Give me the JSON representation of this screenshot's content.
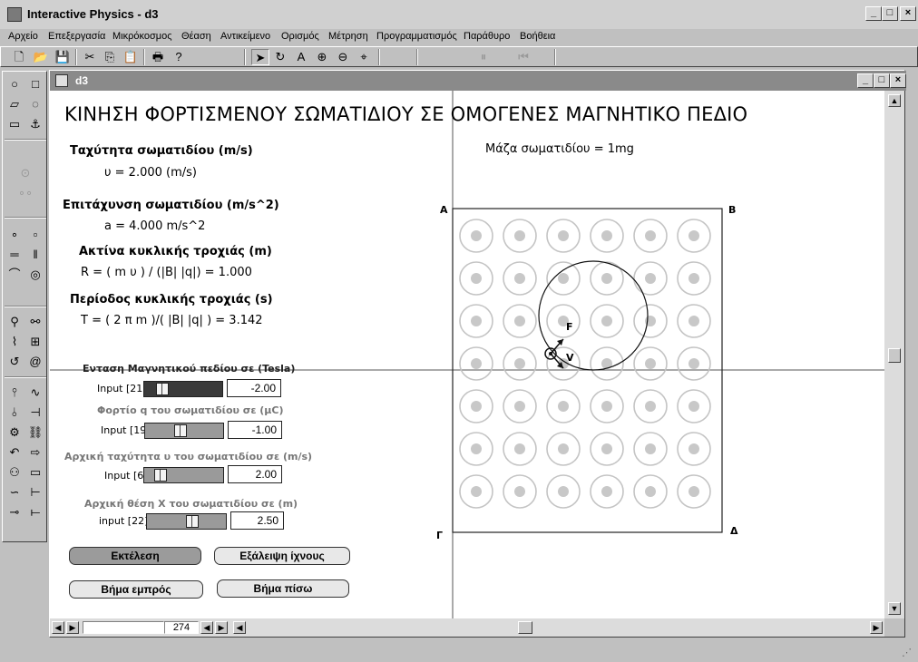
{
  "app": {
    "title": "Interactive Physics - d3",
    "window_controls": [
      "_",
      "□",
      "×"
    ]
  },
  "menu": [
    "Αρχείο",
    "Επεξεργασία",
    "Μικρόκοσμος",
    "Θέαση",
    "Αντικείμενο",
    "Ορισμός",
    "Μέτρηση",
    "Προγραμματισμός",
    "Παράθυρο",
    "Βοήθεια"
  ],
  "document": {
    "title": "d3",
    "window_controls": [
      "_",
      "□",
      "×"
    ]
  },
  "canvas": {
    "heading": "ΚΙΝΗΣΗ ΦΟΡΤΙΣΜΕΝΟΥ ΣΩΜΑΤΙΔΙΟΥ ΣΕ  ΟΜΟΓΕΝΕΣ ΜΑΓΝΗΤΙΚΟ ΠΕΔΙΟ",
    "mass_label": "Μάζα σωματιδίου = 1mg",
    "velocity_label": "Ταχύτητα σωματιδίου  (m/s)",
    "velocity_value": "υ =     2.000   (m/s)",
    "accel_label": "Επιτάχυνση σωματιδίου (m/s^2)",
    "accel_value": "a =      4.000 m/s^2",
    "radius_label": "Ακτίνα κυκλικής τροχιάς  (m)",
    "radius_value": "R =  ( m υ ) / (|B| |q|)  = 1.000",
    "period_label": "Περίοδος  κυκλικής τροχιάς  (s)",
    "period_value": "T = ( 2 π m )/( |B| |q| ) = 3.142",
    "corners": {
      "a": "Α",
      "b": "Β",
      "g": "Γ",
      "d": "Δ"
    },
    "force_label": "F",
    "vel_vector_label": "V"
  },
  "sliders": [
    {
      "label": "Ενταση Μαγνητικού πεδίου σε (Tesla)",
      "input_label": "Input [21]",
      "value": "-2.00",
      "fraction": 0.18
    },
    {
      "label": "Φορτίο q του σωματιδίου σε (μC)",
      "input_label": "Input [19]",
      "value": "-1.00",
      "fraction": 0.45
    },
    {
      "label": "Αρχική ταχύτητα υ του σωματιδίου σε (m/s)",
      "input_label": "Input [6]",
      "value": "2.00",
      "fraction": 0.15
    },
    {
      "label": "Αρχική θέση X του σωματιδίου σε (m)",
      "input_label": "input [22]",
      "value": "2.50",
      "fraction": 0.6
    }
  ],
  "buttons": {
    "run": "Εκτέλεση",
    "erase_trace": "Εξάλειψη ίχνους",
    "step_forward": "Βήμα εμπρός",
    "step_back": "Βήμα πίσω"
  },
  "status": {
    "frame": "274"
  }
}
